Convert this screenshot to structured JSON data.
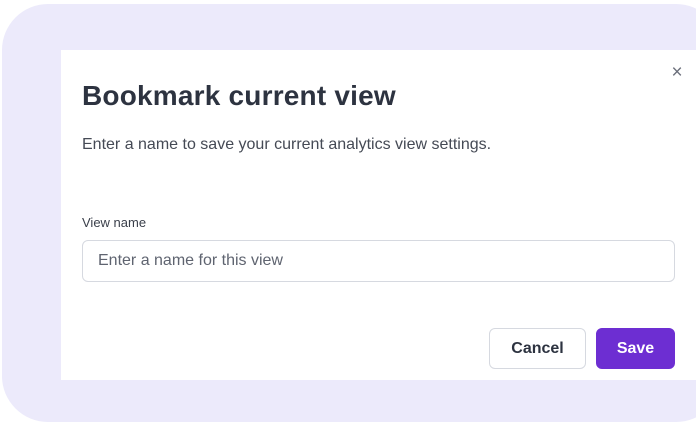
{
  "dialog": {
    "close_glyph": "×",
    "title": "Bookmark current view",
    "description": "Enter a name to save your current analytics view settings.",
    "field_label": "View name",
    "input_value": "",
    "input_placeholder": "Enter a name for this view",
    "cancel_label": "Cancel",
    "save_label": "Save"
  },
  "colors": {
    "backdrop": "#eceafb",
    "accent": "#6d2ed2",
    "title_text": "#2d3340",
    "border": "#d6d9e0"
  },
  "icons": {
    "close": "close-icon"
  }
}
